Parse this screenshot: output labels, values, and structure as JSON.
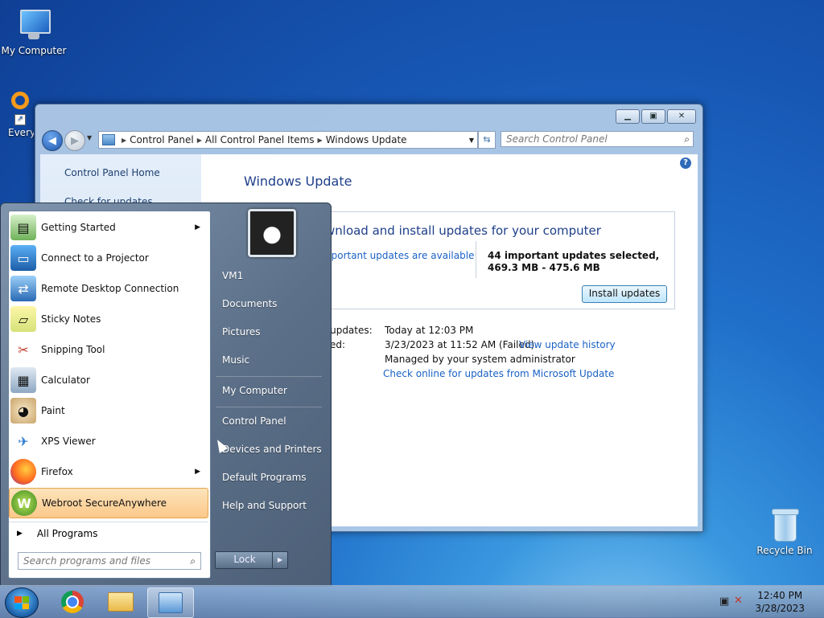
{
  "desktop": {
    "icons": [
      {
        "label": "My Computer",
        "icon": "computer-icon"
      },
      {
        "label": "Everyt",
        "icon": "everything-search-icon"
      },
      {
        "label": "Recycle Bin",
        "icon": "recycle-bin-icon"
      }
    ]
  },
  "control_panel": {
    "breadcrumb": [
      "Control Panel",
      "All Control Panel Items",
      "Windows Update"
    ],
    "search_placeholder": "Search Control Panel",
    "sidebar": {
      "home": "Control Panel Home",
      "check": "Check for updates"
    },
    "title": "Windows Update",
    "status_heading": "wnload and install updates for your computer",
    "available_link": "nportant updates are available",
    "selected_text": "44 important updates selected, 469.3 MB - 475.6 MB",
    "install_button": "Install updates",
    "info": {
      "recent_label": "or updates:",
      "recent_value": "Today at 12:03 PM",
      "installed_label": "ed:",
      "installed_value": "3/23/2023 at 11:52 AM (Failed).",
      "history_link": "View update history",
      "managed": "Managed by your system administrator",
      "online_link": "Check online for updates from Microsoft Update"
    }
  },
  "start_menu": {
    "programs": [
      {
        "label": "Getting Started",
        "icon": "getting-started-icon",
        "submenu": true
      },
      {
        "label": "Connect to a Projector",
        "icon": "projector-icon",
        "submenu": false
      },
      {
        "label": "Remote Desktop Connection",
        "icon": "remote-desktop-icon",
        "submenu": false
      },
      {
        "label": "Sticky Notes",
        "icon": "sticky-notes-icon",
        "submenu": false
      },
      {
        "label": "Snipping Tool",
        "icon": "snipping-tool-icon",
        "submenu": false
      },
      {
        "label": "Calculator",
        "icon": "calculator-icon",
        "submenu": false
      },
      {
        "label": "Paint",
        "icon": "paint-icon",
        "submenu": false
      },
      {
        "label": "XPS Viewer",
        "icon": "xps-viewer-icon",
        "submenu": false
      },
      {
        "label": "Firefox",
        "icon": "firefox-icon",
        "submenu": true
      },
      {
        "label": "Webroot SecureAnywhere",
        "icon": "webroot-icon",
        "submenu": false,
        "highlighted": true
      }
    ],
    "all_programs": "All Programs",
    "search_placeholder": "Search programs and files",
    "right_items": [
      "VM1",
      "Documents",
      "Pictures",
      "Music",
      "My Computer",
      "Control Panel",
      "Devices and Printers",
      "Default Programs",
      "Help and Support"
    ],
    "lock_button": "Lock"
  },
  "taskbar": {
    "buttons": [
      {
        "icon": "chrome-icon"
      },
      {
        "icon": "file-explorer-icon"
      },
      {
        "icon": "control-panel-icon",
        "active": true
      }
    ],
    "clock_time": "12:40 PM",
    "clock_date": "3/28/2023"
  },
  "colors": {
    "link": "#1a62c4",
    "title": "#1e3f8a",
    "highlight": "#fbc98a"
  }
}
